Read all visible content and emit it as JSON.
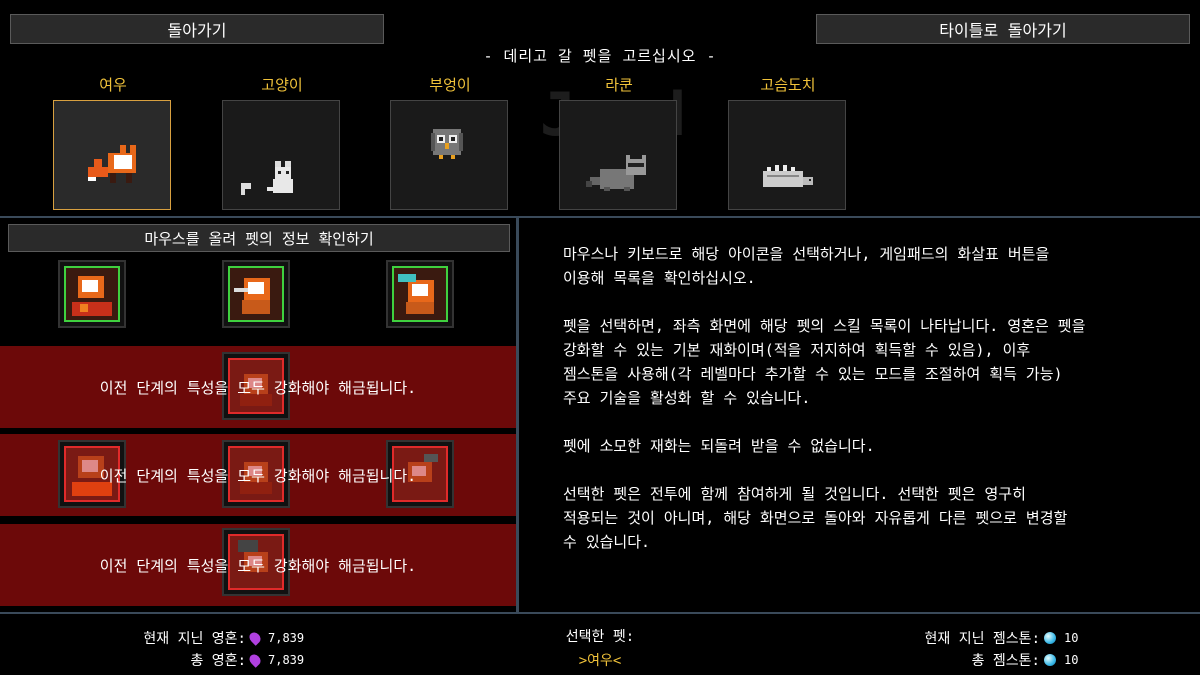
{
  "top": {
    "back_label": "돌아가기",
    "title_label": "타이틀로 돌아가기"
  },
  "subtitle": "- 데리고 갈 펫을 고르십시오 -",
  "pets": [
    {
      "name": "여우",
      "icon": "fox-icon",
      "selected": true
    },
    {
      "name": "고양이",
      "icon": "cat-icon",
      "selected": false
    },
    {
      "name": "부엉이",
      "icon": "owl-icon",
      "selected": false
    },
    {
      "name": "라쿤",
      "icon": "raccoon-icon",
      "selected": false
    },
    {
      "name": "고슴도치",
      "icon": "hedgehog-icon",
      "selected": false
    }
  ],
  "left": {
    "hover_label": "마우스를 올려 펫의 정보 확인하기",
    "locked_message": "이전 단계의 특성을 모두 강화해야 해금됩니다.",
    "tiers": [
      {
        "skills": [
          "fox-skill-1-icon",
          "fox-skill-2-icon",
          "fox-skill-3-icon"
        ],
        "locked": false
      },
      {
        "skills": [
          "fox-skill-4-icon"
        ],
        "locked": true
      },
      {
        "skills": [
          "fox-skill-5-icon",
          "fox-skill-6-icon",
          "fox-skill-7-icon"
        ],
        "locked": true
      },
      {
        "skills": [
          "fox-skill-8-icon"
        ],
        "locked": true
      }
    ]
  },
  "description": {
    "p1": "마우스나 키보드로 해당 아이콘을 선택하거나, 게임패드의 화살표 버튼을\n이용해 목록을 확인하십시오.",
    "p2": "펫을 선택하면, 좌측 화면에 해당 펫의 스킬 목록이 나타납니다. 영혼은 펫을\n강화할 수 있는 기본 재화이며(적을 저지하여 획득할 수 있음), 이후\n젬스톤을 사용해(각 레벨마다 추가할 수 있는 모드를 조절하여 획득 가능)\n주요 기술을 활성화 할 수 있습니다.",
    "p3": "펫에 소모한 재화는 되돌려 받을 수 없습니다.",
    "p4": "선택한 펫은 전투에 함께 참여하게 될 것입니다. 선택한 펫은 영구히\n적용되는 것이 아니며, 해당 화면으로 돌아와 자유롭게 다른 펫으로 변경할\n수 있습니다."
  },
  "footer": {
    "current_souls_label": "현재 지닌 영혼:",
    "current_souls": "7,839",
    "total_souls_label": "총 영혼:",
    "total_souls": "7,839",
    "selected_label": "선택한 펫:",
    "selected_value": ">여우<",
    "current_gems_label": "현재 지닌 젬스톤:",
    "current_gems": "10",
    "total_gems_label": "총 젬스톤:",
    "total_gems": "10"
  },
  "colors": {
    "accent": "#f0c23a",
    "locked": "#780a0a",
    "unlocked_border": "#3fd13f",
    "locked_border": "#e02a2a",
    "soul": "#b040e0",
    "gem": "#38b8e8"
  }
}
